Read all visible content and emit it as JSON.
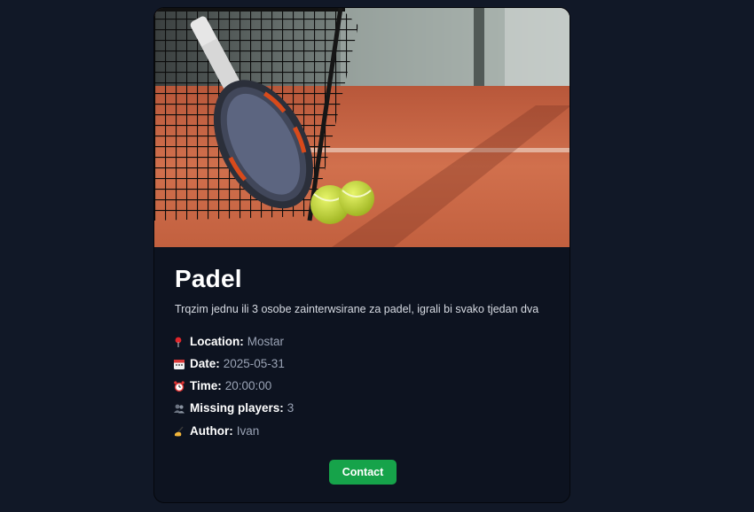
{
  "post": {
    "title": "Padel",
    "description": "Trqzim jednu ili 3 osobe zainterwsirane za padel, igrali bi svako tjedan dva",
    "details": [
      {
        "icon": "pin-icon",
        "label": "Location:",
        "value": "Mostar"
      },
      {
        "icon": "calendar-icon",
        "label": "Date:",
        "value": "2025-05-31"
      },
      {
        "icon": "alarm-clock-icon",
        "label": "Time:",
        "value": "20:00:00"
      },
      {
        "icon": "people-icon",
        "label": "Missing players:",
        "value": "3"
      },
      {
        "icon": "writing-hand-icon",
        "label": "Author:",
        "value": "Ivan"
      }
    ],
    "contact_label": "Contact"
  },
  "colors": {
    "page_background": "#111827",
    "card_background": "#0d1320",
    "button_green": "#16a34a",
    "value_text": "#9aa3b5"
  }
}
